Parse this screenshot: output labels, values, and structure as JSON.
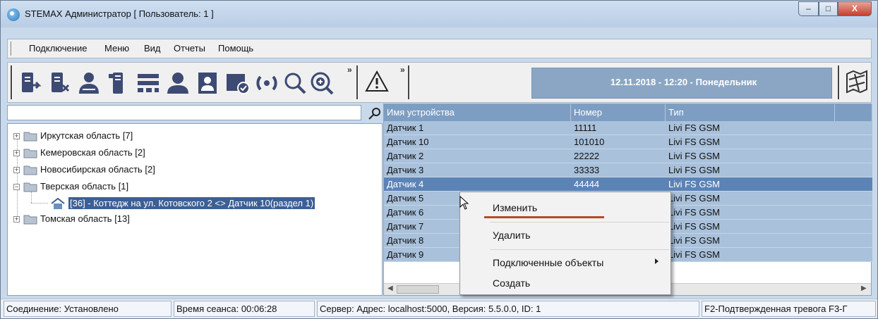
{
  "window": {
    "title": "STEMAX Администратор [ Пользователь: 1 ]",
    "controls": {
      "minimize": "–",
      "maximize": "□",
      "close": "X"
    }
  },
  "menu": [
    {
      "label": "Подключение"
    },
    {
      "label": "Меню"
    },
    {
      "label": "Вид"
    },
    {
      "label": "Отчеты"
    },
    {
      "label": "Помощь"
    }
  ],
  "toolbar": {
    "icons": [
      "connect-icon",
      "disconnect-icon",
      "users-icon",
      "devices-icon",
      "settings-list-icon",
      "user-icon",
      "report-icon",
      "confirm-icon",
      "refresh-icon",
      "search-icon",
      "zoom-in-icon",
      "warning-icon",
      "map-icon"
    ],
    "datetime": "12.11.2018 - 12:20 - Понедельник",
    "more_glyph": "»"
  },
  "tree": {
    "search_value": "",
    "items": [
      {
        "label": "Иркутская область [7]",
        "expander": "+"
      },
      {
        "label": "Кемеровская область [2]",
        "expander": "+"
      },
      {
        "label": "Новосибирская область [2]",
        "expander": "+"
      },
      {
        "label": "Тверская область [1]",
        "expander": "−"
      },
      {
        "label": "[36] - Коттедж на ул. Котовского 2 <> Датчик 10(раздел 1)",
        "expander": ""
      },
      {
        "label": "Томская область [13]",
        "expander": "+"
      }
    ]
  },
  "table": {
    "columns": [
      "Имя устройства",
      "Номер",
      "Тип"
    ],
    "rows": [
      [
        "Датчик 1",
        "11111",
        "Livi FS GSM"
      ],
      [
        "Датчик 10",
        "101010",
        "Livi FS GSM"
      ],
      [
        "Датчик 2",
        "22222",
        "Livi FS GSM"
      ],
      [
        "Датчик 3",
        "33333",
        "Livi FS GSM"
      ],
      [
        "Датчик 4",
        "44444",
        "Livi FS GSM"
      ],
      [
        "Датчик 5",
        "",
        "Livi FS GSM"
      ],
      [
        "Датчик 6",
        "",
        "Livi FS GSM"
      ],
      [
        "Датчик 7",
        "",
        "Livi FS GSM"
      ],
      [
        "Датчик 8",
        "",
        "Livi FS GSM"
      ],
      [
        "Датчик 9",
        "",
        "Livi FS GSM"
      ]
    ],
    "selected_row": 4
  },
  "context_menu": {
    "items": [
      "Изменить",
      "Удалить",
      "Подключенные объекты",
      "Создать"
    ]
  },
  "status": {
    "connection": "Соединение: Установлено",
    "session": "Время сеанса: 00:06:28",
    "server": "Сервер: Адрес: localhost:5000, Версия: 5.5.0.0, ID: 1",
    "hotkeys": "F2-Подтвержденная тревога  F3-Г"
  },
  "colors": {
    "header_blue": "#7d9ec2",
    "row_blue": "#a9c1db",
    "selected_row": "#5c83b5",
    "tree_selection": "#3c5f95",
    "underline": "#b84a28"
  }
}
